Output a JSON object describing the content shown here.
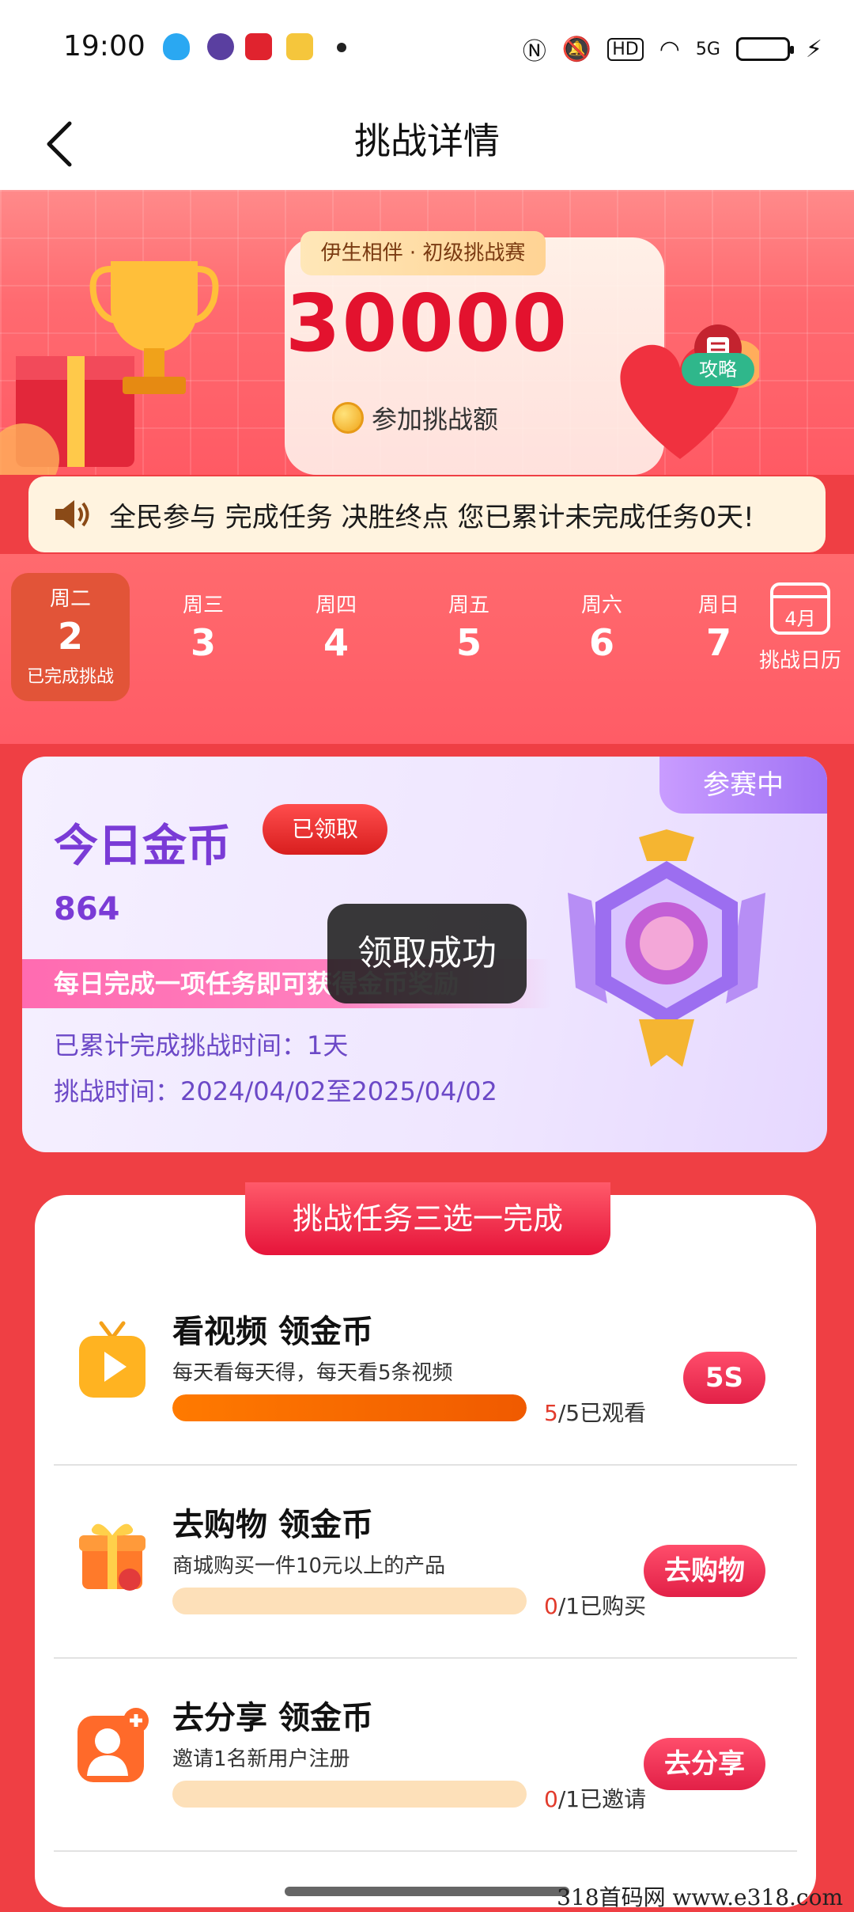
{
  "status_bar": {
    "time": "19:00",
    "net": "5G",
    "hd": "HD"
  },
  "nav": {
    "title": "挑战详情"
  },
  "hero": {
    "badge": "伊生相伴 · 初级挑战赛",
    "amount": "30000",
    "amount_label": "参加挑战额",
    "strategy_label": "攻略"
  },
  "marquee": {
    "text": "全民参与 完成任务 决胜终点 您已累计未完成任务0天!"
  },
  "week": {
    "days": [
      {
        "weekday": "周二",
        "date": "2",
        "status": "已完成挑战"
      },
      {
        "weekday": "周三",
        "date": "3"
      },
      {
        "weekday": "周四",
        "date": "4"
      },
      {
        "weekday": "周五",
        "date": "5"
      },
      {
        "weekday": "周六",
        "date": "6"
      },
      {
        "weekday": "周日",
        "date": "7"
      }
    ],
    "calendar_month": "4月",
    "calendar_label": "挑战日历"
  },
  "today": {
    "tag": "参赛中",
    "title": "今日金币",
    "claimed_label": "已领取",
    "value": "864",
    "daily_tip": "每日完成一项任务即可获得金币奖励",
    "accumulated": "已累计完成挑战时间：1天",
    "period": "挑战时间：2024/04/02至2025/04/02"
  },
  "toast": {
    "text": "领取成功"
  },
  "tasks": {
    "header": "挑战任务三选一完成",
    "items": [
      {
        "title": "看视频 领金币",
        "desc": "每天看每天得，每天看5条视频",
        "done": "5",
        "progress_rest": "/5已观看",
        "button": "5S",
        "progress": 1.0
      },
      {
        "title": "去购物 领金币",
        "desc": "商城购买一件10元以上的产品",
        "done": "0",
        "progress_rest": "/1已购买",
        "button": "去购物",
        "progress": 0
      },
      {
        "title": "去分享 领金币",
        "desc": "邀请1名新用户注册",
        "done": "0",
        "progress_rest": "/1已邀请",
        "button": "去分享",
        "progress": 0
      }
    ]
  },
  "watermark": "318首码网 www.e318.com"
}
